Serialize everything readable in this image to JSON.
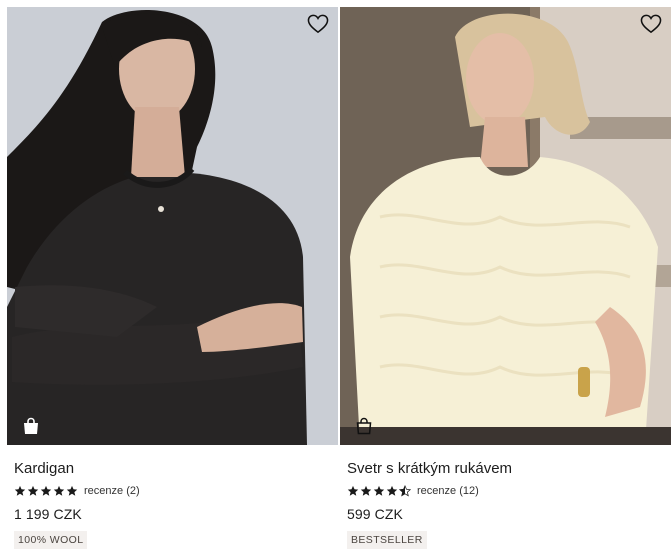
{
  "products": [
    {
      "title": "Kardigan",
      "rating": 5,
      "reviews_label": "recenze (2)",
      "price": "1 199 CZK",
      "tag": "100% WOOL"
    },
    {
      "title": "Svetr s krátkým rukávem",
      "rating": 4.5,
      "reviews_label": "recenze (12)",
      "price": "599 CZK",
      "tag": "BESTSELLER"
    }
  ],
  "icons": {
    "favorite": "heart-icon",
    "bag": "shopping-bag-icon",
    "star": "star-icon"
  },
  "colors": {
    "star": "#1a1a1a",
    "tag_bg": "#f3f0ee"
  }
}
